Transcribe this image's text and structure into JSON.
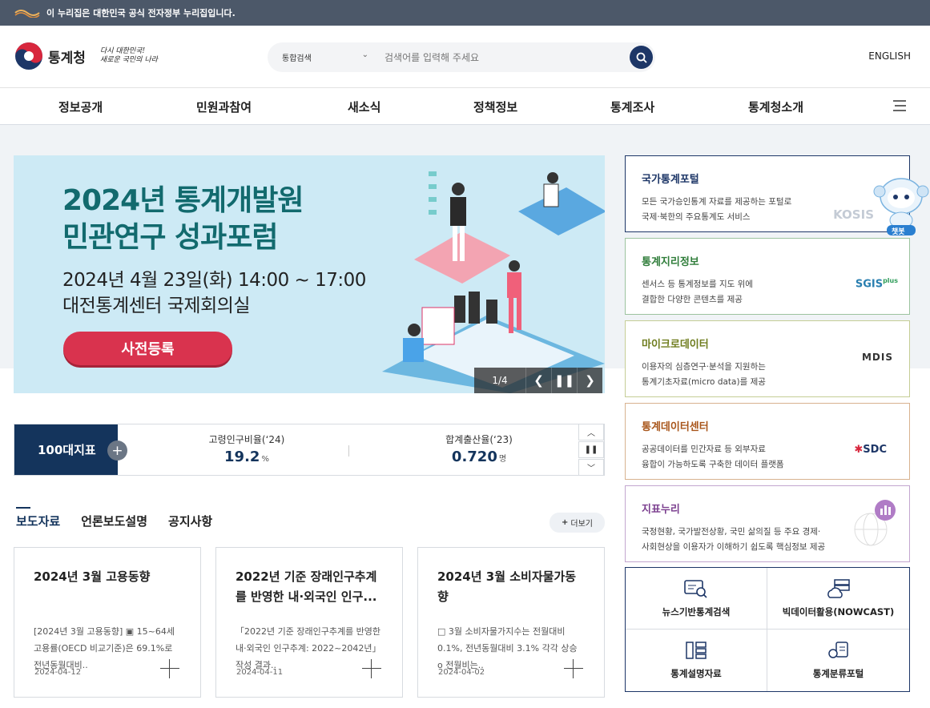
{
  "gov_banner": {
    "text": "이 누리집은 대한민국 공식 전자정부 누리집입니다."
  },
  "header": {
    "agency_name": "통계청",
    "slogan_line1": "다시 대한민국!",
    "slogan_line2": "새로운 국민의 나라",
    "search_category": "통합검색",
    "search_placeholder": "검색어를 입력해 주세요",
    "language_link": "ENGLISH"
  },
  "nav": {
    "items": [
      "정보공개",
      "민원과참여",
      "새소식",
      "정책정보",
      "통계조사",
      "통계청소개"
    ]
  },
  "banner": {
    "title_line1": "2024년 통계개발원",
    "title_line2": "민관연구 성과포럼",
    "date_line": "2024년 4월 23일(화) 14:00 ~ 17:00",
    "place_line": "대전통계센터 국제회의실",
    "register_label": "사전등록",
    "page_indicator": "1/4"
  },
  "indicators": {
    "label": "100대지표",
    "items": [
      {
        "name": "고령인구비율(‘24)",
        "value": "19.2",
        "unit": "%"
      },
      {
        "name": "합계출산율(‘23)",
        "value": "0.720",
        "unit": "명"
      }
    ]
  },
  "news": {
    "tabs": [
      "보도자료",
      "언론보도설명",
      "공지사항"
    ],
    "more_label": "더보기",
    "cards": [
      {
        "title": "2024년 3월 고용동향",
        "body": "[2024년 3월 고용동향] ▣ 15~64세 고용률(OECD 비교기준)은 69.1%로 전년동월대비..",
        "date": "2024-04-12"
      },
      {
        "title": "2022년 기준 장래인구추계를 반영한 내·외국인 인구...",
        "body": "「2022년 기준 장래인구추계를 반영한 내·외국인 인구추계: 2022~2042년」 작성 결과..",
        "date": "2024-04-11"
      },
      {
        "title": "2024년 3월 소비자물가동향",
        "body": "□ 3월 소비자물가지수는 전월대비 0.1%, 전년동월대비 3.1% 각각 상승 o 전월비는..",
        "date": "2024-04-02"
      }
    ]
  },
  "services": [
    {
      "title": "국가통계포털",
      "desc1": "모든 국가승인통계 자료를 제공하는 포털로",
      "desc2": "국제·북한의 주요통계도 서비스",
      "logo": "KOSIS",
      "color": "#1d3667"
    },
    {
      "title": "통계지리정보",
      "desc1": "센서스 등 통계정보를 지도 위에",
      "desc2": "결합한 다양한 콘텐츠를 제공",
      "logo": "SGIS",
      "logo_suffix": "plus",
      "color": "#2f7d3a"
    },
    {
      "title": "마이크로데이터",
      "desc1": "이용자의 심층연구·분석을 지원하는",
      "desc2": "통계기초자료(micro data)를 제공",
      "logo": "MDIS",
      "color": "#6f7d1e"
    },
    {
      "title": "통계데이터센터",
      "desc1": "공공데이터를 민간자료 등 외부자료",
      "desc2": "융합이 가능하도록 구축한 데이터 플랫폼",
      "logo": "SDC",
      "color": "#a8551a"
    },
    {
      "title": "지표누리",
      "desc1": "국정현황, 국가발전상황, 국민 삶의질 등 주요 경제·",
      "desc2": "사회현상을 이용자가 이해하기 쉽도록 핵심정보 제공",
      "logo": "",
      "color": "#7b3f8f"
    }
  ],
  "quick_links": [
    "뉴스기반통계검색",
    "빅데이터활용(NOWCAST)",
    "통계설명자료",
    "통계분류포털"
  ],
  "chatbot": {
    "label": "챗봇"
  }
}
